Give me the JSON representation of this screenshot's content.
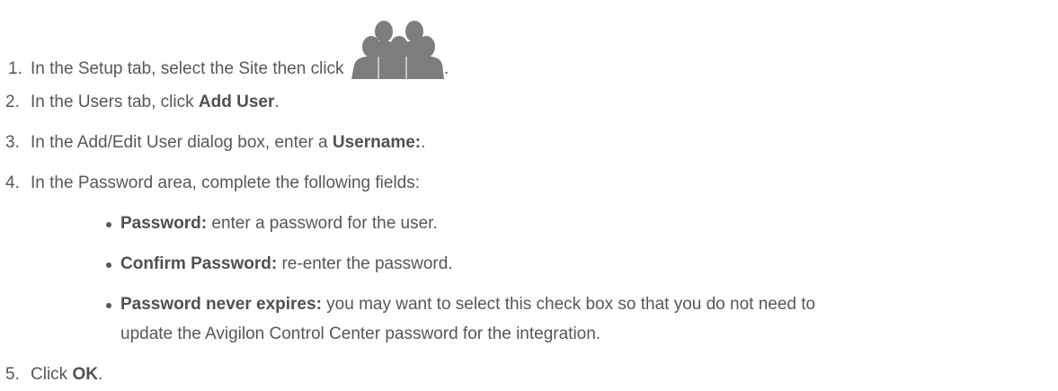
{
  "steps": [
    {
      "num": "1.",
      "text": "In the Setup tab, select the Site then click ",
      "after": "."
    },
    {
      "num": "2.",
      "pre": "In the Users tab, click ",
      "bold": "Add User",
      "post": "."
    },
    {
      "num": "3.",
      "pre": "In the Add/Edit User dialog box, enter a ",
      "bold": "Username:",
      "post": "."
    },
    {
      "num": "4.",
      "text": "In the Password area, complete the following fields:"
    },
    {
      "num": "5.",
      "pre": "Click ",
      "bold": "OK",
      "post": "."
    }
  ],
  "fields": [
    {
      "label": "Password:",
      "desc": " enter a password for the user."
    },
    {
      "label": "Confirm Password:",
      "desc": " re-enter the password."
    },
    {
      "label": "Password never expires:",
      "desc": " you may want to select this check box so that you do not need to",
      "desc2": "update the Avigilon Control Center password for the integration."
    }
  ],
  "icons": {
    "users": "users-icon"
  },
  "colors": {
    "text": "#575757",
    "icon": "#7d7d7d"
  }
}
